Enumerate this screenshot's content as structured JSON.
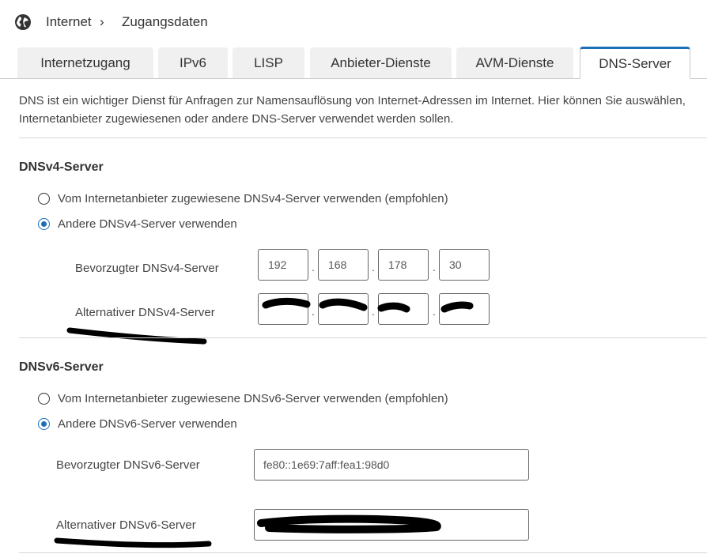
{
  "breadcrumb": {
    "root": "Internet",
    "separator": "›",
    "current": "Zugangsdaten"
  },
  "tabs": [
    {
      "label": "Internetzugang"
    },
    {
      "label": "IPv6"
    },
    {
      "label": "LISP"
    },
    {
      "label": "Anbieter-Dienste"
    },
    {
      "label": "AVM-Dienste"
    },
    {
      "label": "DNS-Server"
    }
  ],
  "intro": {
    "line1": "DNS ist ein wichtiger Dienst für Anfragen zur Namensauflösung von Internet-Adressen im Internet. Hier können Sie auswählen,",
    "line2": "Internetanbieter zugewiesenen oder andere DNS-Server verwendet werden sollen."
  },
  "dnsv4": {
    "title": "DNSv4-Server",
    "option_provider": "Vom Internetanbieter zugewiesene DNSv4-Server verwenden (empfohlen)",
    "option_other": "Andere DNSv4-Server verwenden",
    "selected": "other",
    "preferred_label": "Bevorzugter DNSv4-Server",
    "preferred": [
      "192",
      "168",
      "178",
      "30"
    ],
    "alternative_label": "Alternativer DNSv4-Server",
    "dot": "."
  },
  "dnsv6": {
    "title": "DNSv6-Server",
    "option_provider": "Vom Internetanbieter zugewiesene DNSv6-Server verwenden (empfohlen)",
    "option_other": "Andere DNSv6-Server verwenden",
    "selected": "other",
    "preferred_label": "Bevorzugter DNSv6-Server",
    "preferred": "fe80::1e69:7aff:fea1:98d0",
    "alternative_label": "Alternativer DNSv6-Server"
  },
  "colors": {
    "accent": "#1d6fb8",
    "tab_bg": "#f0f0f0",
    "redaction": "#000000"
  },
  "icons": {
    "globe": "globe-icon"
  }
}
